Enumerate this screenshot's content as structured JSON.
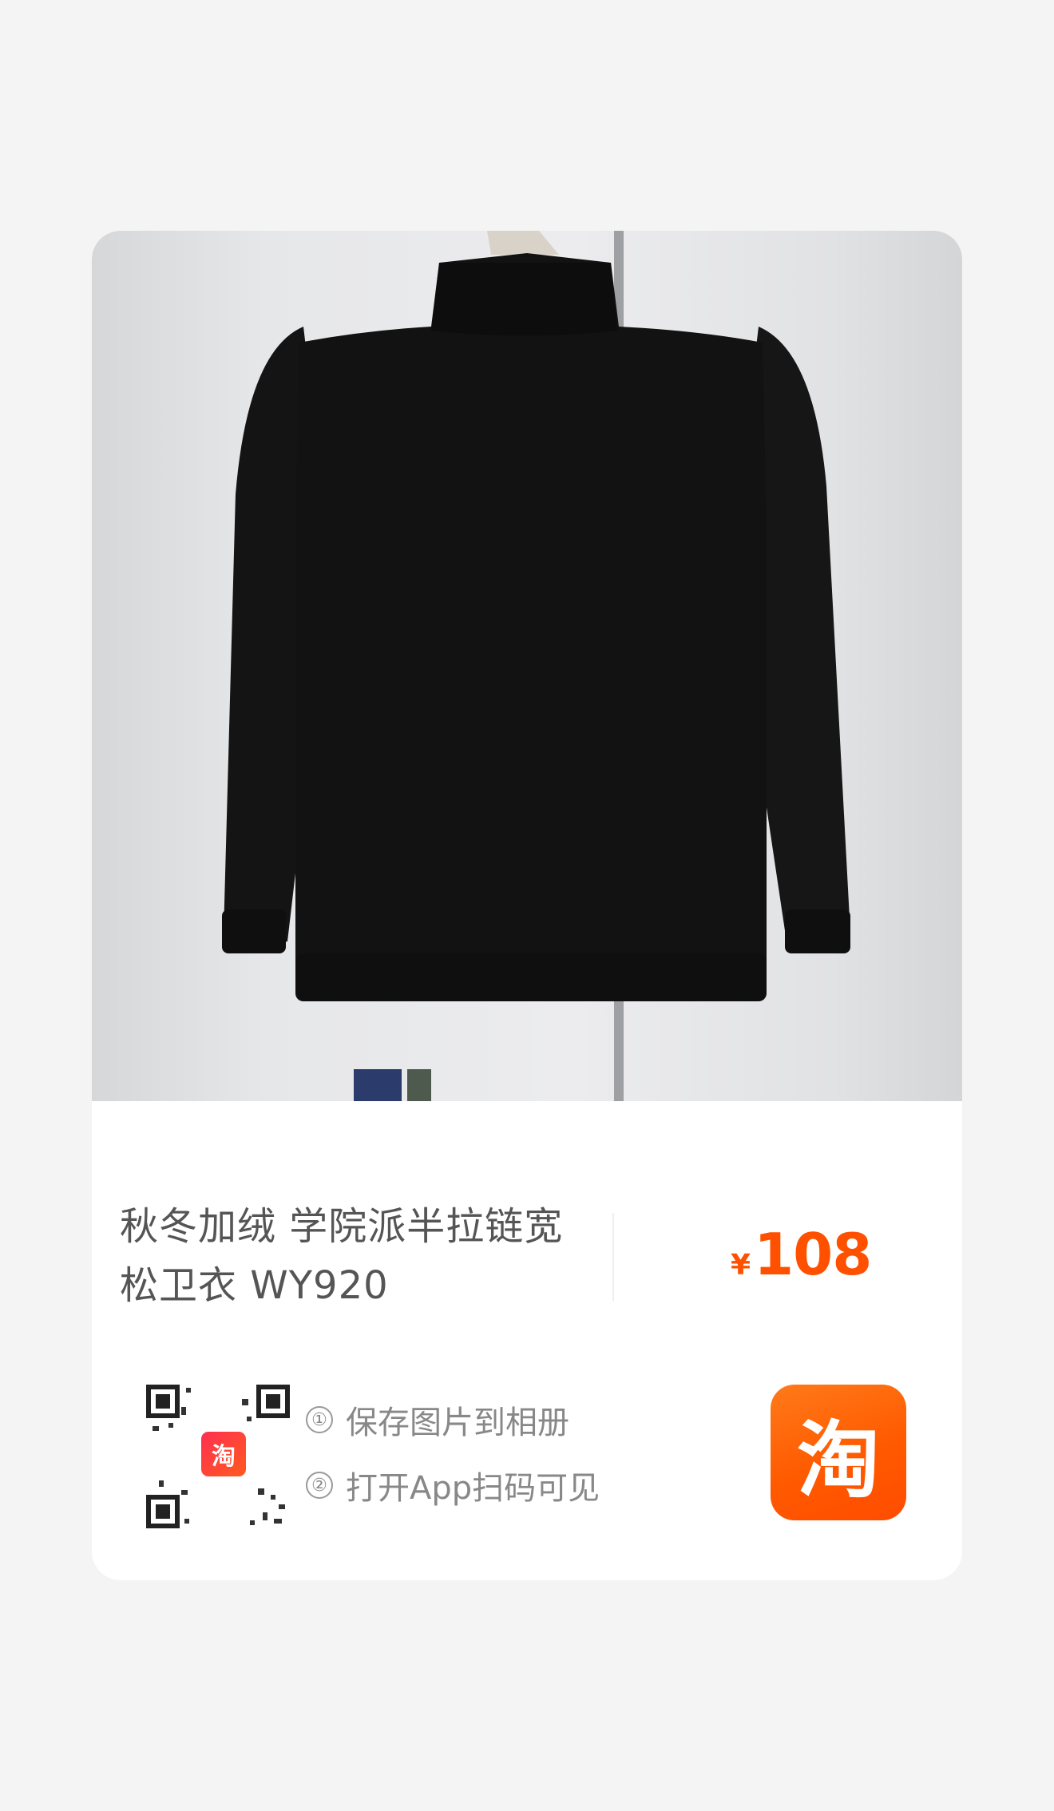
{
  "product": {
    "title": "秋冬加绒 学院派半拉链宽松卫衣 WY920",
    "image_icon": "sweatshirt-photo",
    "price_currency": "¥",
    "price_value": "108"
  },
  "share": {
    "qr_logo_text": "淘",
    "step1_marker": "①",
    "step1_text": "保存图片到相册",
    "step2_marker": "②",
    "step2_text": "打开App扫码可见"
  },
  "brand": {
    "logo_text": "淘",
    "logo_icon": "taobao-logo-icon"
  },
  "colors": {
    "price": "#ff5000",
    "brand_orange": "#ff5a00",
    "text_gray": "#555555",
    "background": "#f4f4f4",
    "card": "#ffffff"
  }
}
